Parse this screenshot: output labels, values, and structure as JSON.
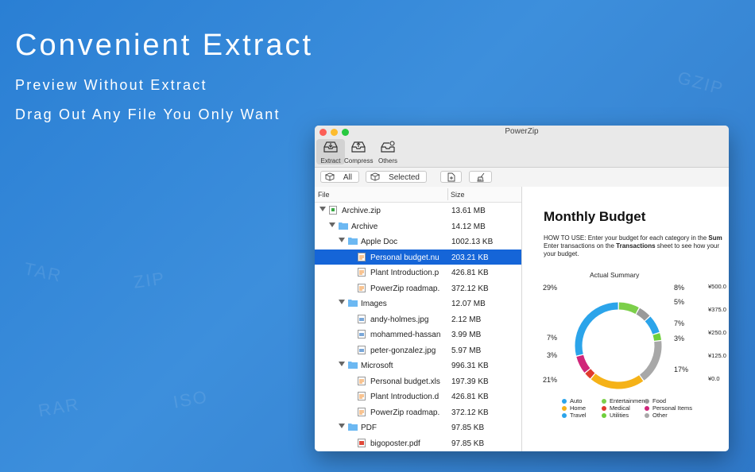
{
  "hero": {
    "title": "Convenient Extract",
    "subtitle1": "Preview Without Extract",
    "subtitle2": "Drag Out Any File You Only Want"
  },
  "watermarks": [
    "TAR",
    "ZIP",
    "RAR",
    "ISO",
    "GZIP"
  ],
  "window": {
    "title": "PowerZip",
    "toolbar": [
      {
        "label": "Extract",
        "icon": "extract-tray-icon",
        "active": true
      },
      {
        "label": "Compress",
        "icon": "compress-tray-icon",
        "active": false
      },
      {
        "label": "Others",
        "icon": "others-tray-icon",
        "active": false
      }
    ],
    "actions": {
      "all_label": "All",
      "selected_label": "Selected"
    },
    "columns": {
      "file": "File",
      "size": "Size"
    },
    "files": [
      {
        "name": "Archive.zip",
        "size": "13.61 MB",
        "depth": 0,
        "type": "zip",
        "expanded": true
      },
      {
        "name": "Archive",
        "size": "14.12 MB",
        "depth": 1,
        "type": "folder",
        "expanded": true
      },
      {
        "name": "Apple Doc",
        "size": "1002.13 KB",
        "depth": 2,
        "type": "folder",
        "expanded": true
      },
      {
        "name": "Personal budget.nu",
        "size": "203.21 KB",
        "depth": 3,
        "type": "doc",
        "selected": true
      },
      {
        "name": "Plant Introduction.p",
        "size": "426.81 KB",
        "depth": 3,
        "type": "doc"
      },
      {
        "name": "PowerZip roadmap.",
        "size": "372.12 KB",
        "depth": 3,
        "type": "doc"
      },
      {
        "name": "Images",
        "size": "12.07 MB",
        "depth": 2,
        "type": "folder",
        "expanded": true
      },
      {
        "name": "andy-holmes.jpg",
        "size": "2.12 MB",
        "depth": 3,
        "type": "image"
      },
      {
        "name": "mohammed-hassan",
        "size": "3.99 MB",
        "depth": 3,
        "type": "image"
      },
      {
        "name": "peter-gonzalez.jpg",
        "size": "5.97 MB",
        "depth": 3,
        "type": "image"
      },
      {
        "name": "Microsoft",
        "size": "996.31 KB",
        "depth": 2,
        "type": "folder",
        "expanded": true
      },
      {
        "name": "Personal budget.xls",
        "size": "197.39 KB",
        "depth": 3,
        "type": "doc"
      },
      {
        "name": "Plant Introduction.d",
        "size": "426.81 KB",
        "depth": 3,
        "type": "doc"
      },
      {
        "name": "PowerZip roadmap.",
        "size": "372.12 KB",
        "depth": 3,
        "type": "doc"
      },
      {
        "name": "PDF",
        "size": "97.85 KB",
        "depth": 2,
        "type": "folder",
        "expanded": true
      },
      {
        "name": "bigoposter.pdf",
        "size": "97.85 KB",
        "depth": 3,
        "type": "pdf"
      }
    ],
    "preview": {
      "title": "Monthly Budget",
      "how_to_line1_prefix": "HOW TO USE: Enter your budget for each category in the ",
      "how_to_line1_bold": "Sum",
      "how_to_line2_prefix": "Enter transactions on the ",
      "how_to_line2_bold": "Transactions",
      "how_to_line2_suffix": " sheet to see how your",
      "how_to_line3": "your budget.",
      "chart_title": "Actual Summary",
      "percent_labels": [
        "29%",
        "8%",
        "5%",
        "7%",
        "3%",
        "17%",
        "21%",
        "3%",
        "7%"
      ],
      "currency_labels": [
        "¥500.0",
        "¥375.0",
        "¥250.0",
        "¥125.0",
        "¥0.0"
      ],
      "legend": [
        "Auto",
        "Entertainment",
        "Food",
        "Home",
        "Medical",
        "Personal Items",
        "Travel",
        "Utilities",
        "Other"
      ]
    }
  },
  "colors": {
    "background": "#2f80d0",
    "selection": "#1565d8",
    "auto": "#2ba4ea",
    "entertainment": "#7ccf4a",
    "food": "#999999",
    "home": "#f5b218",
    "medical": "#e03a2c",
    "personal_items": "#d0267a",
    "travel": "#2ba4ea",
    "utilities": "#6fcf3c",
    "other": "#a8a8a8"
  }
}
